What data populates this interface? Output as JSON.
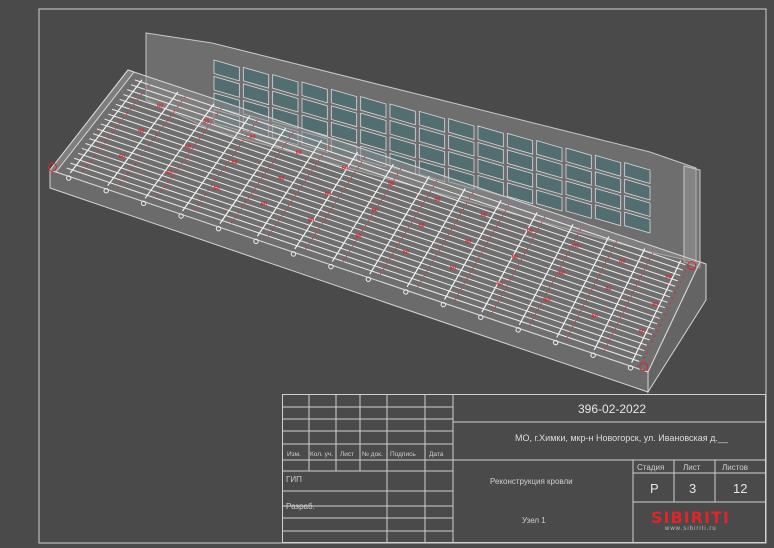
{
  "drawing": {
    "rail_labels": [
      "60",
      "60",
      "60",
      "60",
      "60",
      "60",
      "60",
      "60",
      "60",
      "60",
      "60",
      "60"
    ]
  },
  "title_block": {
    "code": "396-02-2022",
    "address": "МО, г.Химки, мкр-н Новогорск, ул. Ивановская д.__",
    "columns": [
      "Изм.",
      "Кол. уч.",
      "Лист",
      "№ док.",
      "Подпись",
      "Дата"
    ],
    "row_gip": "ГИП",
    "row_razrab": "Разраб.",
    "project": "Реконструкция кровли",
    "sheet_name": "Узел 1",
    "stage_label": "Стадия",
    "sheet_label": "Лист",
    "sheets_label": "Листов",
    "stage_value": "Р",
    "sheet_value": "3",
    "sheets_value": "12"
  },
  "logo": {
    "name": "SIBIRITI",
    "site": "www.sibiriti.ru"
  },
  "colors": {
    "background": "#4a4a4a",
    "frame": "#d0d0d0",
    "glass": "#4f6e72",
    "accent": "#e0242a"
  }
}
